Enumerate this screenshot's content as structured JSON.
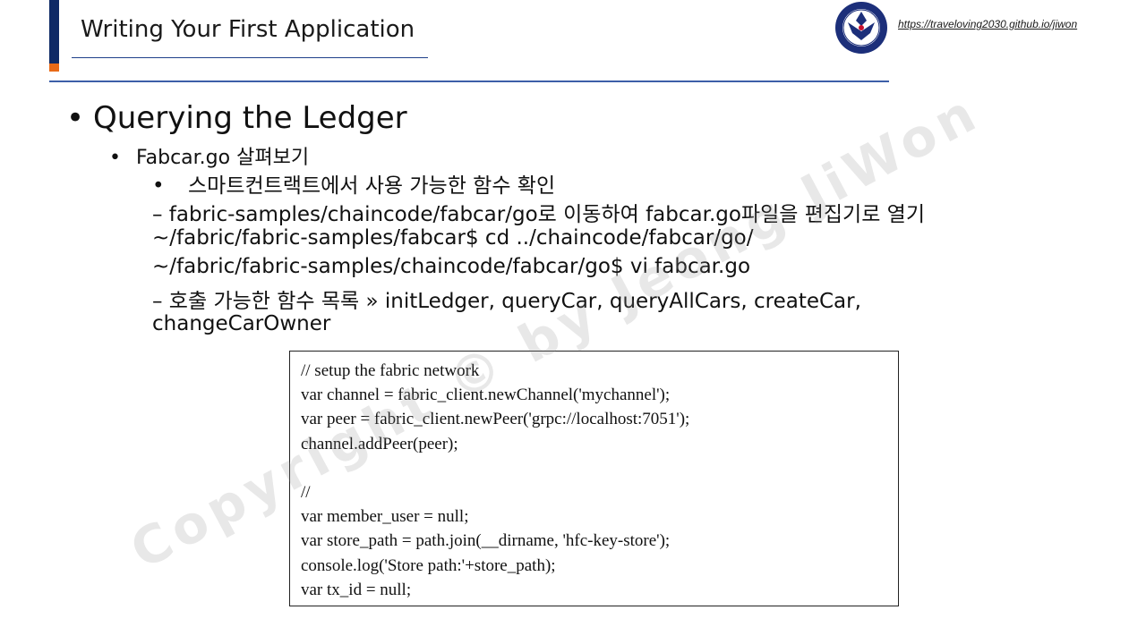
{
  "header": {
    "title": "Writing Your First Application",
    "url": "https://traveloving2030.github.io/jiwon",
    "logo_icon": "university-emblem-logo",
    "accent_color": "#0f2a66",
    "accent_orange": "#e86a18"
  },
  "watermark": "Copyright © by Jeong JiWon",
  "content": {
    "heading": "Querying the Ledger",
    "subheading": "Fabcar.go 살펴보기",
    "sub_bullet": "스마트컨트랙트에서 사용 가능한 함수 확인",
    "lines": [
      "– fabric-samples/chaincode/fabcar/go로 이동하여 fabcar.go파일을 편집기로 열기",
      "~/fabric/fabric-samples/fabcar$ cd ../chaincode/fabcar/go/",
      "~/fabric/fabric-samples/chaincode/fabcar/go$ vi fabcar.go",
      "– 호출 가능한 함수 목록 » initLedger, queryCar, queryAllCars, createCar,",
      "changeCarOwner"
    ]
  },
  "code": {
    "lines": [
      "// setup the fabric network",
      "var channel = fabric_client.newChannel('mychannel');",
      "var peer = fabric_client.newPeer('grpc://localhost:7051');",
      "channel.addPeer(peer);",
      "",
      "//",
      "var member_user = null;",
      "var store_path = path.join(__dirname, 'hfc-key-store');",
      "console.log('Store path:'+store_path);",
      "var tx_id = null;"
    ]
  }
}
